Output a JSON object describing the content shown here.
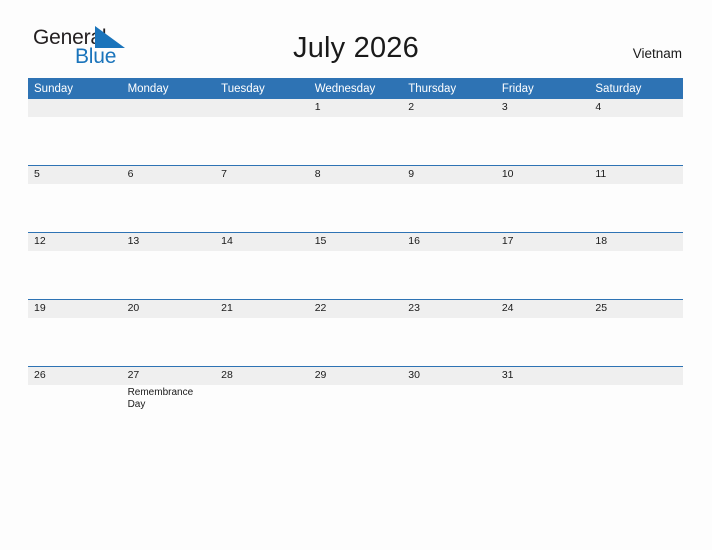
{
  "header": {
    "logo": {
      "word_one": "General",
      "word_two": "Blue",
      "flag_icon": "blue-triangle-flag-icon",
      "accent_color": "#1a74bb"
    },
    "title": "July 2026",
    "country": "Vietnam"
  },
  "calendar": {
    "header_color": "#2e73b4",
    "daynum_band_color": "#efefef",
    "weekday_headers": [
      "Sunday",
      "Monday",
      "Tuesday",
      "Wednesday",
      "Thursday",
      "Friday",
      "Saturday"
    ],
    "weeks": [
      {
        "days": [
          {
            "num": "",
            "event": ""
          },
          {
            "num": "",
            "event": ""
          },
          {
            "num": "",
            "event": ""
          },
          {
            "num": "1",
            "event": ""
          },
          {
            "num": "2",
            "event": ""
          },
          {
            "num": "3",
            "event": ""
          },
          {
            "num": "4",
            "event": ""
          }
        ]
      },
      {
        "days": [
          {
            "num": "5",
            "event": ""
          },
          {
            "num": "6",
            "event": ""
          },
          {
            "num": "7",
            "event": ""
          },
          {
            "num": "8",
            "event": ""
          },
          {
            "num": "9",
            "event": ""
          },
          {
            "num": "10",
            "event": ""
          },
          {
            "num": "11",
            "event": ""
          }
        ]
      },
      {
        "days": [
          {
            "num": "12",
            "event": ""
          },
          {
            "num": "13",
            "event": ""
          },
          {
            "num": "14",
            "event": ""
          },
          {
            "num": "15",
            "event": ""
          },
          {
            "num": "16",
            "event": ""
          },
          {
            "num": "17",
            "event": ""
          },
          {
            "num": "18",
            "event": ""
          }
        ]
      },
      {
        "days": [
          {
            "num": "19",
            "event": ""
          },
          {
            "num": "20",
            "event": ""
          },
          {
            "num": "21",
            "event": ""
          },
          {
            "num": "22",
            "event": ""
          },
          {
            "num": "23",
            "event": ""
          },
          {
            "num": "24",
            "event": ""
          },
          {
            "num": "25",
            "event": ""
          }
        ]
      },
      {
        "days": [
          {
            "num": "26",
            "event": ""
          },
          {
            "num": "27",
            "event": "Remembrance Day"
          },
          {
            "num": "28",
            "event": ""
          },
          {
            "num": "29",
            "event": ""
          },
          {
            "num": "30",
            "event": ""
          },
          {
            "num": "31",
            "event": ""
          },
          {
            "num": "",
            "event": ""
          }
        ]
      }
    ]
  }
}
